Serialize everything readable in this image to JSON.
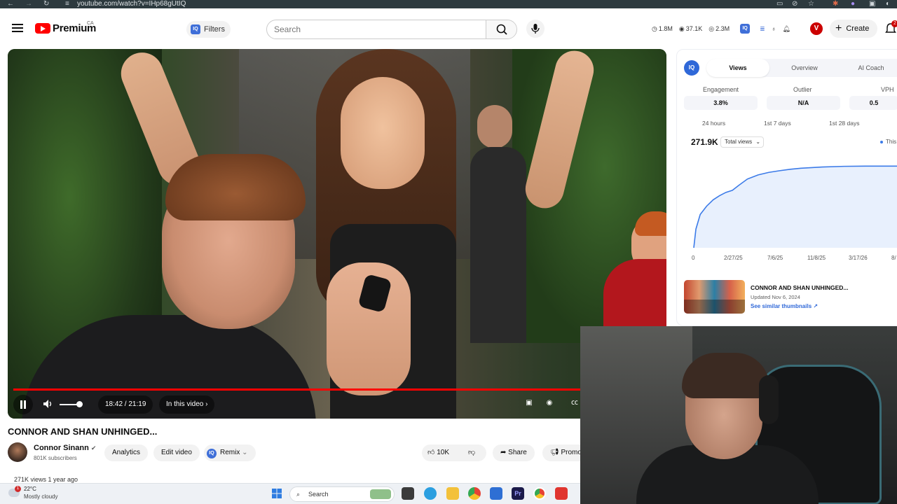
{
  "browser": {
    "url": "youtube.com/watch?v=IHp68gUtIQ"
  },
  "header": {
    "brand": "Premium",
    "region": "CA",
    "filters_label": "Filters",
    "search_placeholder": "Search",
    "stats": [
      {
        "icon": "clock-icon",
        "value": "1.8M"
      },
      {
        "icon": "eye-icon",
        "value": "37.1K"
      },
      {
        "icon": "eye-icon",
        "value": "2.3M"
      }
    ],
    "avatar_letter": "V",
    "create_label": "Create",
    "notification_count": "2"
  },
  "player": {
    "time": "18:42 / 21:19",
    "chapters_label": "In this video",
    "progress": 0.878,
    "volume": 0.8
  },
  "video": {
    "title": "CONNOR AND SHAN UNHINGED...",
    "channel_name": "Connor Sinann",
    "subscribers": "801K subscribers",
    "meta": "271K views  1 year ago",
    "actions": {
      "analytics": "Analytics",
      "edit": "Edit video",
      "remix": "Remix",
      "likes": "10K",
      "share": "Share",
      "promote": "Promo"
    }
  },
  "iq_panel": {
    "logo": "IQ",
    "tabs": [
      "Views",
      "Overview",
      "AI Coach"
    ],
    "active_tab": "Views",
    "metrics": [
      {
        "label": "Engagement",
        "value": "3.8%"
      },
      {
        "label": "Outlier",
        "value": "N/A"
      },
      {
        "label": "VPH",
        "value": "0.5"
      }
    ],
    "ranges": [
      "24 hours",
      "1st 7 days",
      "1st 28 days"
    ],
    "total": "271.9K",
    "dropdown": "Total views",
    "legend": "This",
    "thumb": {
      "title": "CONNOR AND SHAN UNHINGED...",
      "updated": "Updated Nov 6, 2024",
      "link": "See similar thumbnails ↗"
    }
  },
  "chart_data": {
    "type": "area",
    "x_ticks": [
      "0",
      "2/27/25",
      "7/6/25",
      "11/8/25",
      "3/17/26",
      "8/"
    ],
    "series": [
      {
        "x": [
          0,
          0.01,
          0.03,
          0.06,
          0.09,
          0.12,
          0.15,
          0.18,
          0.21,
          0.25,
          0.3,
          0.35,
          0.4,
          0.45,
          0.5,
          0.6,
          0.7,
          0.8,
          0.9,
          1.0
        ],
        "y": [
          0,
          90,
          160,
          200,
          230,
          250,
          266,
          276,
          300,
          330,
          350,
          362,
          370,
          377,
          382,
          388,
          391,
          392,
          392,
          392
        ]
      }
    ],
    "ylim": [
      0,
      420
    ],
    "grid": false
  },
  "taskbar": {
    "temp": "22°C",
    "weather": "Mostly cloudy",
    "weather_badge": "1",
    "search": "Search"
  }
}
